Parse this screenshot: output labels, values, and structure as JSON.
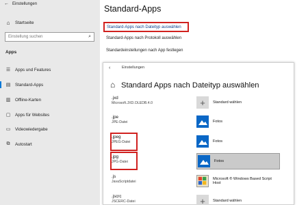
{
  "window": {
    "title": "Einstellungen"
  },
  "sidebar": {
    "home_label": "Startseite",
    "search_placeholder": "Einstellung suchen",
    "section_label": "Apps",
    "items": [
      {
        "label": "Apps und Features",
        "icon": "apps-list-icon"
      },
      {
        "label": "Standard-Apps",
        "icon": "default-apps-icon"
      },
      {
        "label": "Offline-Karten",
        "icon": "map-icon"
      },
      {
        "label": "Apps für Websites",
        "icon": "web-app-icon"
      },
      {
        "label": "Videowiedergabe",
        "icon": "video-icon"
      },
      {
        "label": "Autostart",
        "icon": "startup-icon"
      }
    ]
  },
  "main": {
    "title": "Standard-Apps",
    "links": [
      {
        "label": "Standard-Apps nach Dateityp auswählen"
      },
      {
        "label": "Standard-Apps nach Protokoll auswählen"
      },
      {
        "label": "Standardeinstellungen nach App festlegen"
      }
    ]
  },
  "filetypes_window": {
    "title": "Einstellungen",
    "heading": "Standard Apps nach Dateityp auswählen",
    "rows": [
      {
        "ext": ".jxd",
        "desc": "Microsoft.JXD.OLEDB.4.0",
        "app": "Standard wählen",
        "icon": "plus"
      },
      {
        "ext": ".jpe",
        "desc": "JPE-Datei",
        "app": "Fotos",
        "icon": "photos"
      },
      {
        "ext": ".jpeg",
        "desc": "JPEG-Datei",
        "app": "Fotos",
        "icon": "photos"
      },
      {
        "ext": ".jpg",
        "desc": "JPG-Datei",
        "app": "Fotos",
        "icon": "photos",
        "selected": true
      },
      {
        "ext": ".js",
        "desc": "JavaScriptdatei",
        "app": "Microsoft ® Windows Based Script Host",
        "icon": "wsh"
      },
      {
        "ext": ".jscrc",
        "desc": "JSCERC-Datei",
        "app": "Standard wählen",
        "icon": "plus"
      }
    ]
  },
  "colors": {
    "highlight": "#d0201e",
    "accent": "#0078d7",
    "photos_tile": "#0a67c6"
  }
}
